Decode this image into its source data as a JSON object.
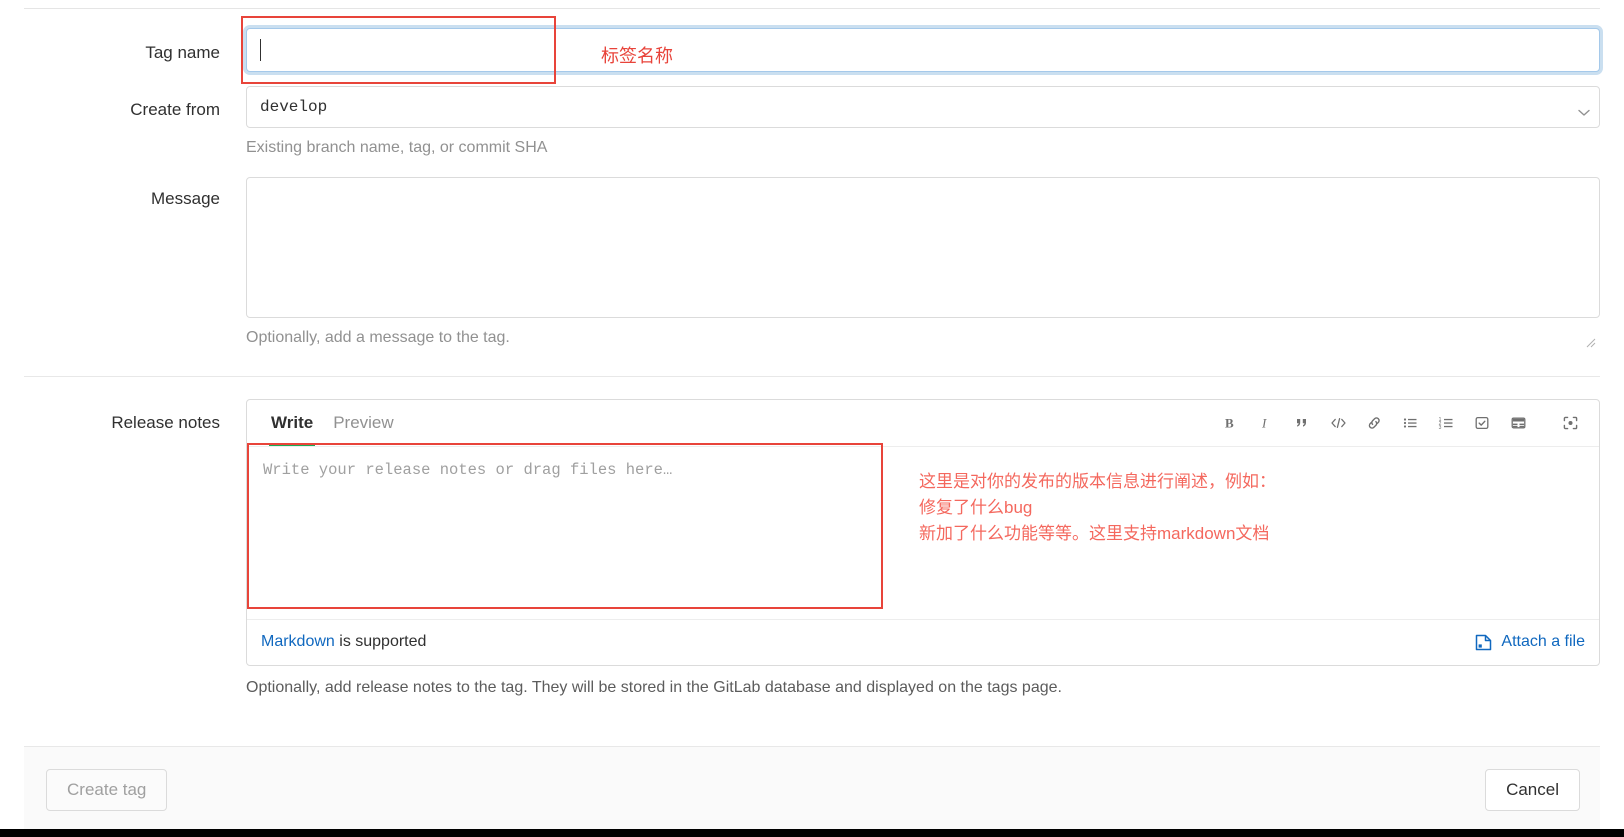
{
  "form": {
    "tag_name": {
      "label": "Tag name",
      "value": "",
      "placeholder": "",
      "annotation": "标签名称"
    },
    "create_from": {
      "label": "Create from",
      "value": "develop",
      "help": "Existing branch name, tag, or commit SHA",
      "chevron_icon": "chevron-down-icon"
    },
    "message": {
      "label": "Message",
      "value": "",
      "help": "Optionally, add a message to the tag."
    },
    "release_notes": {
      "label": "Release notes",
      "tabs": [
        {
          "label": "Write",
          "active": true
        },
        {
          "label": "Preview",
          "active": false
        }
      ],
      "toolbar": [
        {
          "name": "bold-icon",
          "title": "Bold"
        },
        {
          "name": "italic-icon",
          "title": "Italic"
        },
        {
          "name": "quote-icon",
          "title": "Insert a quote"
        },
        {
          "name": "code-icon",
          "title": "Insert code"
        },
        {
          "name": "link-icon",
          "title": "Add a link"
        },
        {
          "name": "bullet-list-icon",
          "title": "Add a bullet list"
        },
        {
          "name": "numbered-list-icon",
          "title": "Add a numbered list"
        },
        {
          "name": "task-list-icon",
          "title": "Add a task list"
        },
        {
          "name": "table-icon",
          "title": "Add a table"
        },
        {
          "name": "fullscreen-icon",
          "title": "Go full screen"
        }
      ],
      "editor_value": "",
      "editor_placeholder": "Write your release notes or drag files here…",
      "annotation_lines": [
        "这里是对你的发布的版本信息进行阐述，例如：",
        "修复了什么bug",
        "新加了什么功能等等。这里支持markdown文档"
      ],
      "footer": {
        "markdown_link": "Markdown",
        "markdown_suffix": " is supported",
        "attach_label": "Attach a file",
        "attach_icon": "attach-file-icon"
      },
      "help": "Optionally, add release notes to the tag. They will be stored in the GitLab database and displayed on the tags page."
    }
  },
  "actions": {
    "create_label": "Create tag",
    "cancel_label": "Cancel"
  },
  "colors": {
    "annotation_red": "#f2645a",
    "annotation_border": "#e8443a",
    "accent_green": "#1aaa55",
    "link_blue": "#1068bf",
    "focus_blue": "#a5c9ea"
  }
}
